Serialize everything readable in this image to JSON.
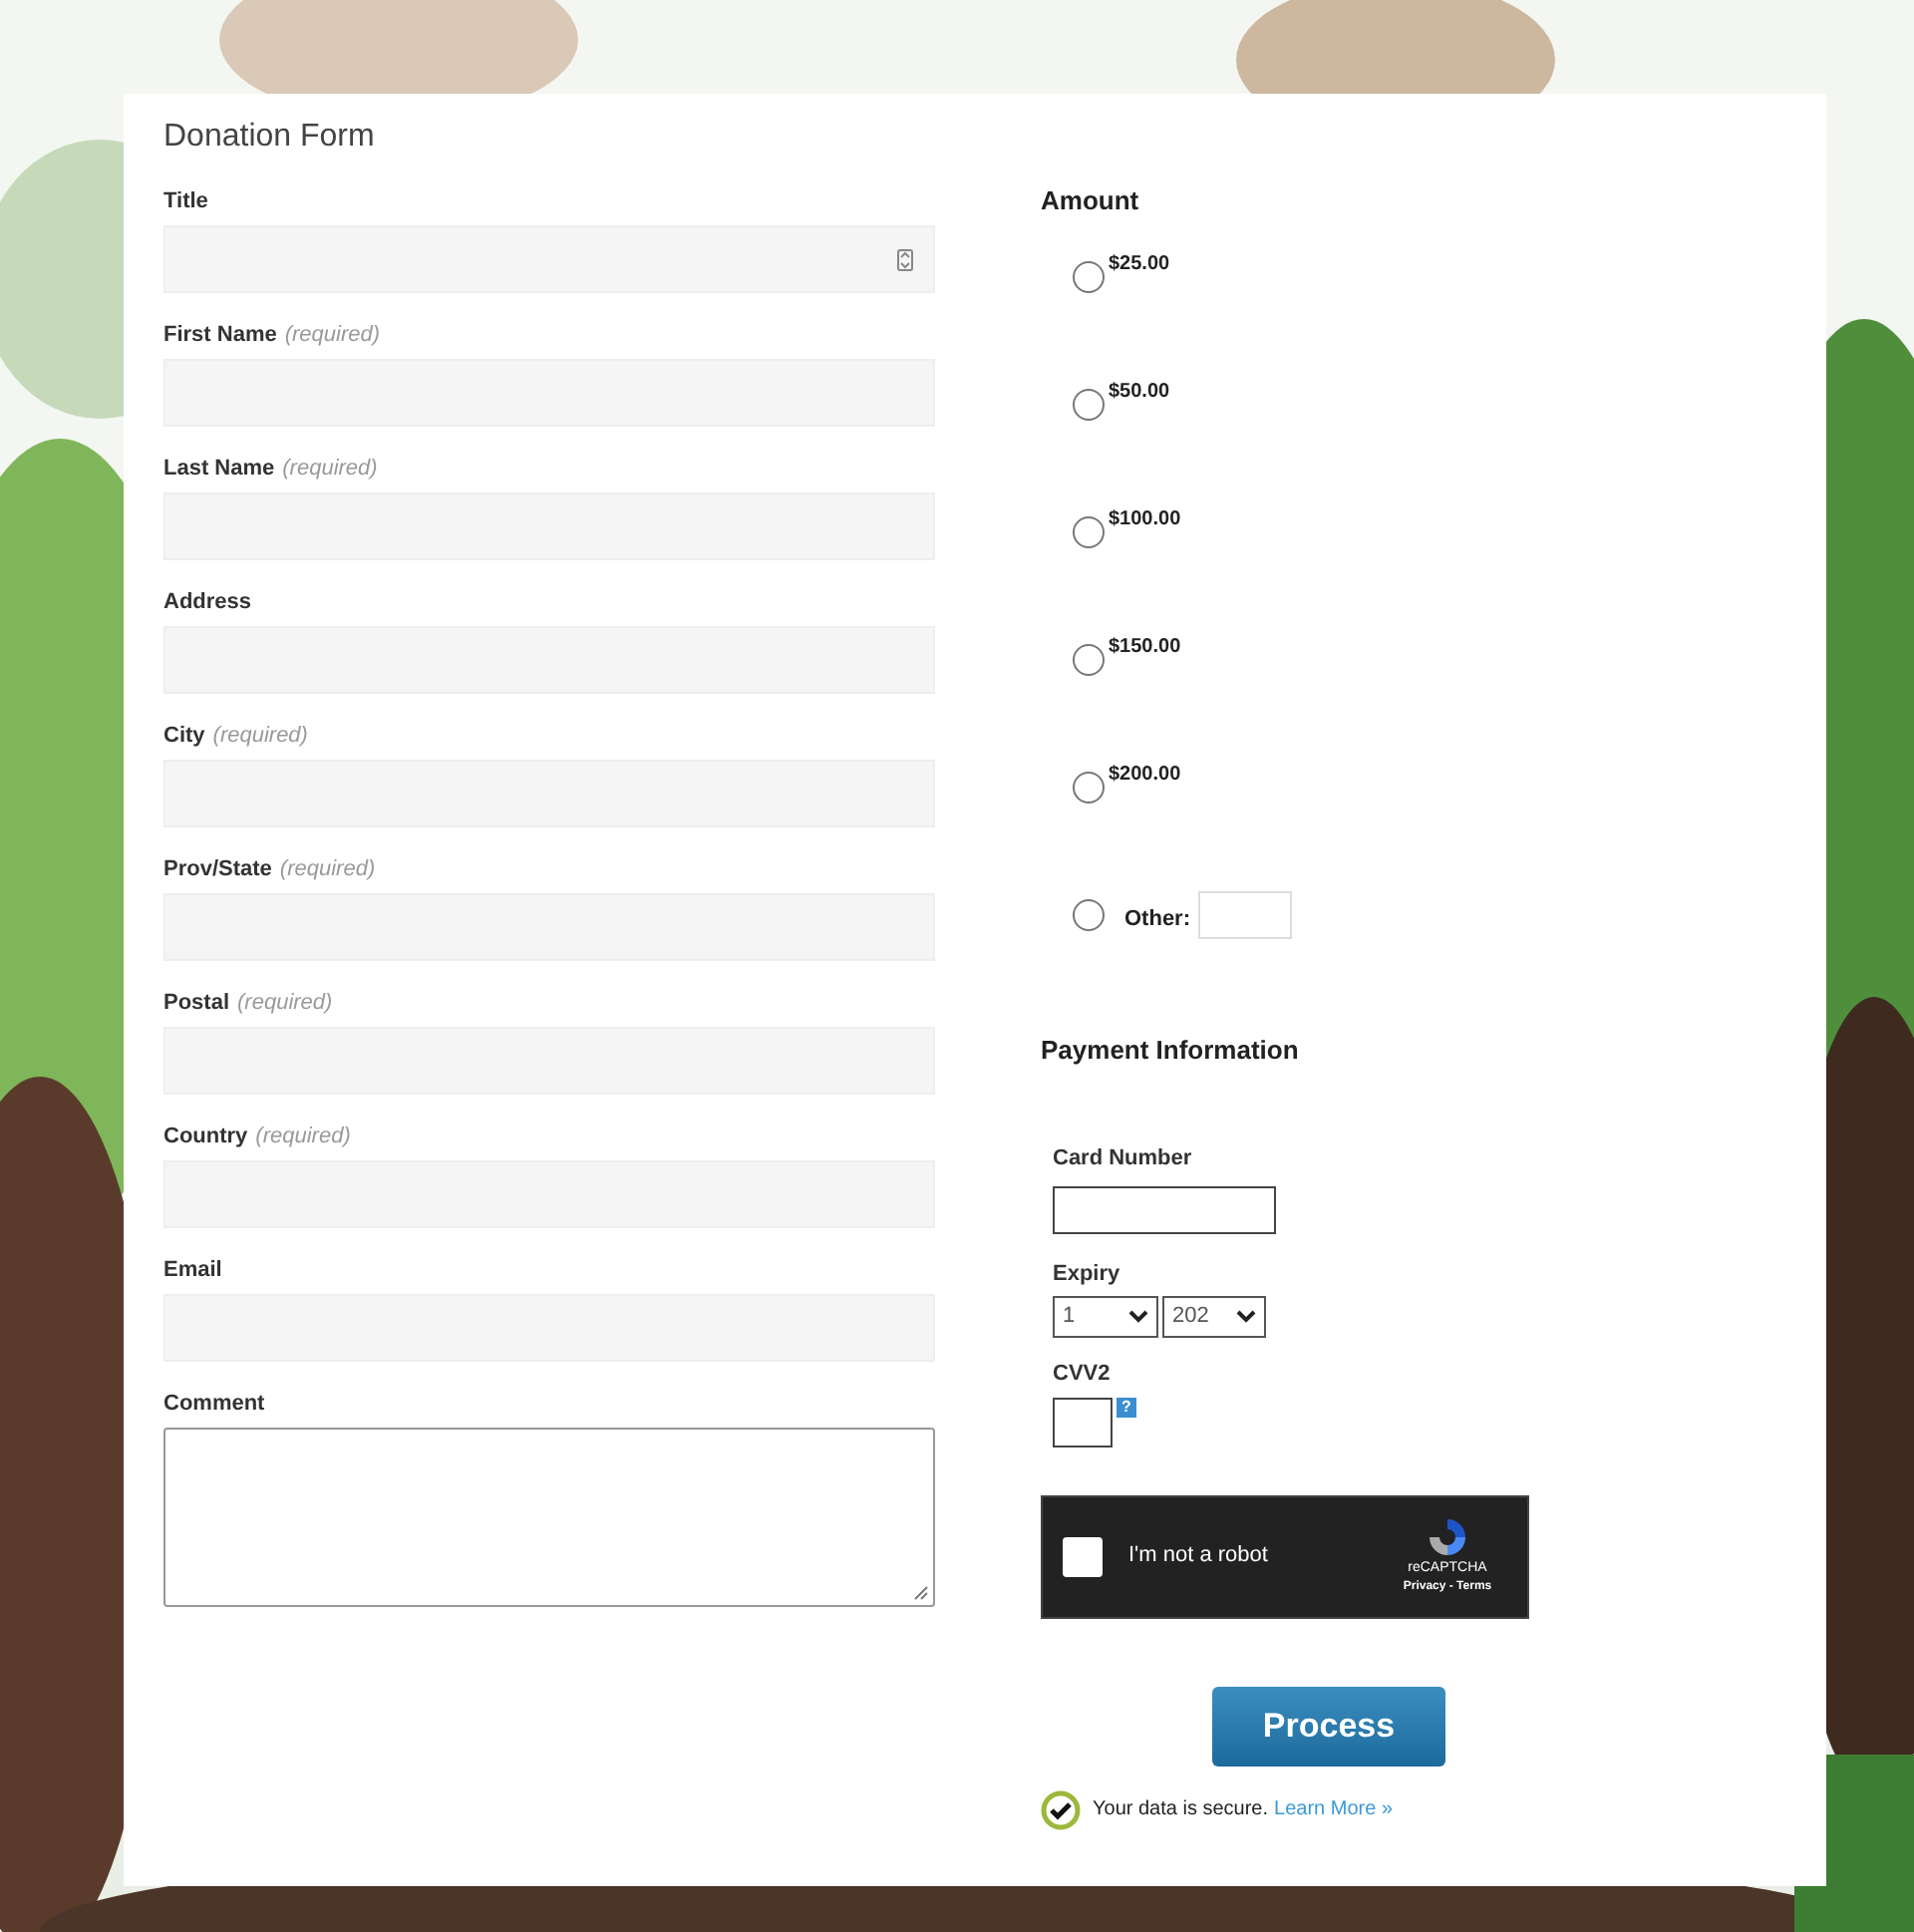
{
  "form_title": "Donation Form",
  "fields": [
    {
      "label": "Title",
      "kind": "select"
    },
    {
      "label": "First Name",
      "required_note": "(required)",
      "kind": "text"
    },
    {
      "label": "Last Name",
      "required_note": "(required)",
      "kind": "text"
    },
    {
      "label": "Address",
      "kind": "text"
    },
    {
      "label": "City",
      "required_note": "(required)",
      "kind": "text"
    },
    {
      "label": "Prov/State",
      "required_note": "(required)",
      "kind": "text"
    },
    {
      "label": "Postal",
      "required_note": "(required)",
      "kind": "text"
    },
    {
      "label": "Country",
      "required_note": "(required)",
      "kind": "text"
    },
    {
      "label": "Email",
      "kind": "text"
    },
    {
      "label": "Comment",
      "kind": "textarea"
    }
  ],
  "amount": {
    "heading": "Amount",
    "options": [
      {
        "label": "$25.00",
        "selected": false
      },
      {
        "label": "$50.00",
        "selected": false
      },
      {
        "label": "$100.00",
        "selected": false
      },
      {
        "label": "$150.00",
        "selected": false
      },
      {
        "label": "$200.00",
        "selected": false
      },
      {
        "label": "Other:",
        "selected": false,
        "kind": "other"
      }
    ]
  },
  "payment": {
    "heading": "Payment Information",
    "card_number_label": "Card Number",
    "expiry_label": "Expiry",
    "expiry_month": "1",
    "expiry_year": "202",
    "cvv_label": "CVV2",
    "cvv_help": "?"
  },
  "captcha": {
    "label": "I'm not a robot",
    "checked": false,
    "brand": "reCAPTCHA",
    "links": "Privacy - Terms"
  },
  "submit": "Process",
  "secure_note": {
    "text": "Your data is secure.",
    "link": "Learn More »"
  }
}
